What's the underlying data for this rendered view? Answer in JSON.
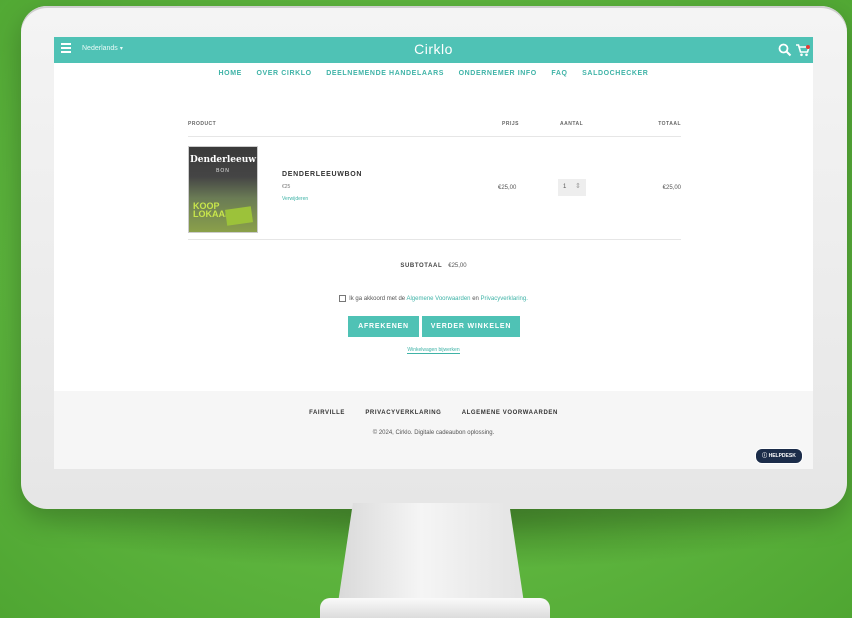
{
  "header": {
    "language": "Nederlands",
    "brand": "Cirklo"
  },
  "nav": {
    "items": [
      "HOME",
      "OVER CIRKLO",
      "DEELNEMENDE HANDELAARS",
      "ONDERNEMER INFO",
      "FAQ",
      "SALDOCHECKER"
    ]
  },
  "cart": {
    "headers": {
      "product": "PRODUCT",
      "price": "PRIJS",
      "quantity": "AANTAL",
      "total": "TOTAAL"
    },
    "item": {
      "thumb_title": "Denderleeuw",
      "thumb_sub": "BON",
      "thumb_slogan_1": "KOOP",
      "thumb_slogan_2": "LOKAAL",
      "name": "DENDERLEEUWBON",
      "variant": "€25",
      "remove": "Verwijderen",
      "price": "€25,00",
      "quantity": "1",
      "total": "€25,00"
    },
    "subtotal_label": "SUBTOTAAL",
    "subtotal_value": "€25,00",
    "agree_prefix": "Ik ga akkoord met de",
    "agree_terms": "Algemene Voorwaarden",
    "agree_and": "en",
    "agree_privacy": "Privacyverklaring.",
    "checkout_button": "AFREKENEN",
    "continue_button": "VERDER WINKELEN",
    "update_link": "Winkelwagen bijwerken"
  },
  "footer": {
    "links": [
      "FAIRVILLE",
      "PRIVACYVERKLARING",
      "ALGEMENE VOORWAARDEN"
    ],
    "copyright": "© 2024, Cirklo. Digitale cadeaubon oplossing."
  },
  "helpdesk": "HELPDESK",
  "colors": {
    "accent": "#4fc2b5",
    "background": "#5fb63f",
    "helpdesk": "#1c2d4a"
  },
  "icons": [
    "menu-icon",
    "chevron-down-icon",
    "search-icon",
    "cart-icon",
    "help-icon"
  ]
}
